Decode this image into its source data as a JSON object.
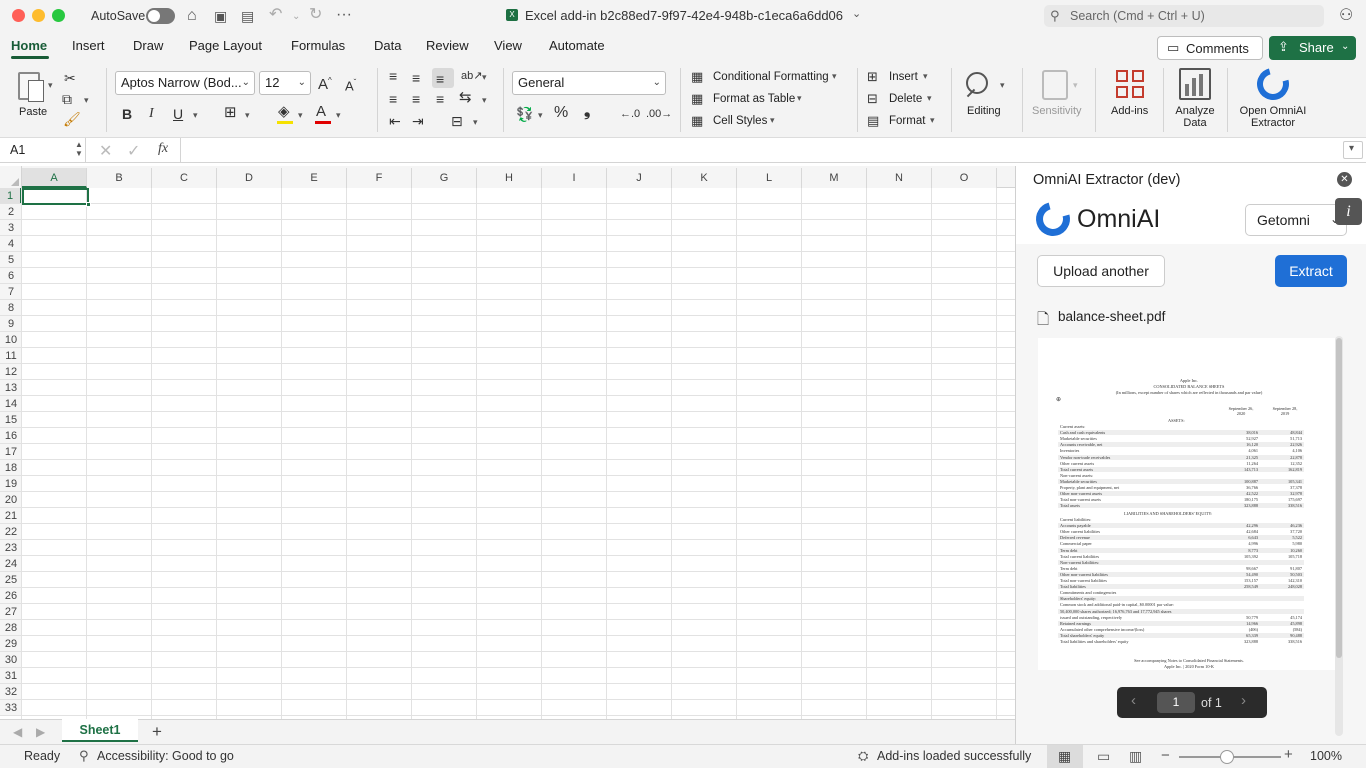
{
  "titlebar": {
    "autosave_label": "AutoSave",
    "doc_title": "Excel add-in b2c88ed7-9f97-42e4-948b-c1eca6a6dd06",
    "search_placeholder": "Search (Cmd + Ctrl + U)"
  },
  "tabs": [
    "Home",
    "Insert",
    "Draw",
    "Page Layout",
    "Formulas",
    "Data",
    "Review",
    "View",
    "Automate"
  ],
  "actions": {
    "comments": "Comments",
    "share": "Share"
  },
  "ribbon": {
    "paste": "Paste",
    "font_name": "Aptos Narrow (Bod...",
    "font_size": "12",
    "number_format": "General",
    "conditional_formatting": "Conditional Formatting",
    "format_as_table": "Format as Table",
    "cell_styles": "Cell Styles",
    "insert": "Insert",
    "delete": "Delete",
    "format": "Format",
    "editing": "Editing",
    "sensitivity": "Sensitivity",
    "addins": "Add-ins",
    "analyze_l1": "Analyze",
    "analyze_l2": "Data",
    "omni_l1": "Open OmniAI",
    "omni_l2": "Extractor"
  },
  "formula_bar": {
    "name_box": "A1",
    "fx": "fx",
    "value": ""
  },
  "columns": [
    "A",
    "B",
    "C",
    "D",
    "E",
    "F",
    "G",
    "H",
    "I",
    "J",
    "K",
    "L",
    "M",
    "N",
    "O"
  ],
  "rows": [
    "1",
    "2",
    "3",
    "4",
    "5",
    "6",
    "7",
    "8",
    "9",
    "10",
    "11",
    "12",
    "13",
    "14",
    "15",
    "16",
    "17",
    "18",
    "19",
    "20",
    "21",
    "22",
    "23",
    "24",
    "25",
    "26",
    "27",
    "28",
    "29",
    "30",
    "31",
    "32",
    "33"
  ],
  "sheet_tab": "Sheet1",
  "status": {
    "ready": "Ready",
    "accessibility": "Accessibility: Good to go",
    "addins": "Add-ins loaded successfully",
    "zoom": "100%"
  },
  "pane": {
    "title": "OmniAI Extractor (dev)",
    "brand": "OmniAI",
    "workspace": "Getomni",
    "upload": "Upload another",
    "extract": "Extract",
    "filename": "balance-sheet.pdf",
    "page_current": "1",
    "page_total": "of 1"
  },
  "pdf": {
    "company": "Apple Inc.",
    "title": "CONSOLIDATED BALANCE SHEETS",
    "subtitle": "(In millions, except number of shares which are reflected in thousands and par value)",
    "col1": "September 26, 2020",
    "col2": "September 28, 2019",
    "assets": "ASSETS:",
    "liab": "LIABILITIES AND SHAREHOLDERS' EQUITY:",
    "rows": [
      {
        "l": "Current assets:",
        "a": "",
        "b": ""
      },
      {
        "l": "   Cash and cash equivalents",
        "a": "38,016",
        "b": "48,844"
      },
      {
        "l": "   Marketable securities",
        "a": "52,927",
        "b": "51,713"
      },
      {
        "l": "   Accounts receivable, net",
        "a": "16,120",
        "b": "22,926"
      },
      {
        "l": "   Inventories",
        "a": "4,061",
        "b": "4,106"
      },
      {
        "l": "   Vendor non-trade receivables",
        "a": "21,325",
        "b": "22,878"
      },
      {
        "l": "   Other current assets",
        "a": "11,264",
        "b": "12,352"
      },
      {
        "l": "      Total current assets",
        "a": "143,713",
        "b": "162,819"
      },
      {
        "l": "Non-current assets:",
        "a": "",
        "b": ""
      },
      {
        "l": "   Marketable securities",
        "a": "100,887",
        "b": "105,341"
      },
      {
        "l": "   Property, plant and equipment, net",
        "a": "36,766",
        "b": "37,378"
      },
      {
        "l": "   Other non-current assets",
        "a": "42,522",
        "b": "32,978"
      },
      {
        "l": "      Total non-current assets",
        "a": "180,175",
        "b": "175,697"
      },
      {
        "l": "         Total assets",
        "a": "323,888",
        "b": "338,516"
      }
    ],
    "rows2": [
      {
        "l": "Current liabilities:",
        "a": "",
        "b": ""
      },
      {
        "l": "   Accounts payable",
        "a": "42,296",
        "b": "46,236"
      },
      {
        "l": "   Other current liabilities",
        "a": "42,684",
        "b": "37,720"
      },
      {
        "l": "   Deferred revenue",
        "a": "6,643",
        "b": "5,522"
      },
      {
        "l": "   Commercial paper",
        "a": "4,996",
        "b": "5,980"
      },
      {
        "l": "   Term debt",
        "a": "8,773",
        "b": "10,260"
      },
      {
        "l": "      Total current liabilities",
        "a": "105,392",
        "b": "105,718"
      },
      {
        "l": "Non-current liabilities:",
        "a": "",
        "b": ""
      },
      {
        "l": "   Term debt",
        "a": "98,667",
        "b": "91,807"
      },
      {
        "l": "   Other non-current liabilities",
        "a": "54,490",
        "b": "50,503"
      },
      {
        "l": "      Total non-current liabilities",
        "a": "153,157",
        "b": "142,310"
      },
      {
        "l": "         Total liabilities",
        "a": "258,549",
        "b": "248,028"
      },
      {
        "l": "Commitments and contingencies",
        "a": "",
        "b": ""
      },
      {
        "l": "Shareholders' equity:",
        "a": "",
        "b": ""
      },
      {
        "l": "   Common stock and additional paid-in capital, $0.00001 par value:",
        "a": "",
        "b": ""
      },
      {
        "l": "   50,400,000 shares authorized; 16,976,763 and 17,772,945 shares",
        "a": "",
        "b": ""
      },
      {
        "l": "   issued and outstanding, respectively",
        "a": "50,779",
        "b": "45,174"
      },
      {
        "l": "   Retained earnings",
        "a": "14,966",
        "b": "45,898"
      },
      {
        "l": "   Accumulated other comprehensive income/(loss)",
        "a": "(406)",
        "b": "(584)"
      },
      {
        "l": "      Total shareholders' equity",
        "a": "65,339",
        "b": "90,488"
      },
      {
        "l": "         Total liabilities and shareholders' equity",
        "a": "323,888",
        "b": "338,516"
      }
    ],
    "footer": "See accompanying Notes to Consolidated Financial Statements.",
    "footer2": "Apple Inc. | 2020 Form 10-K"
  }
}
